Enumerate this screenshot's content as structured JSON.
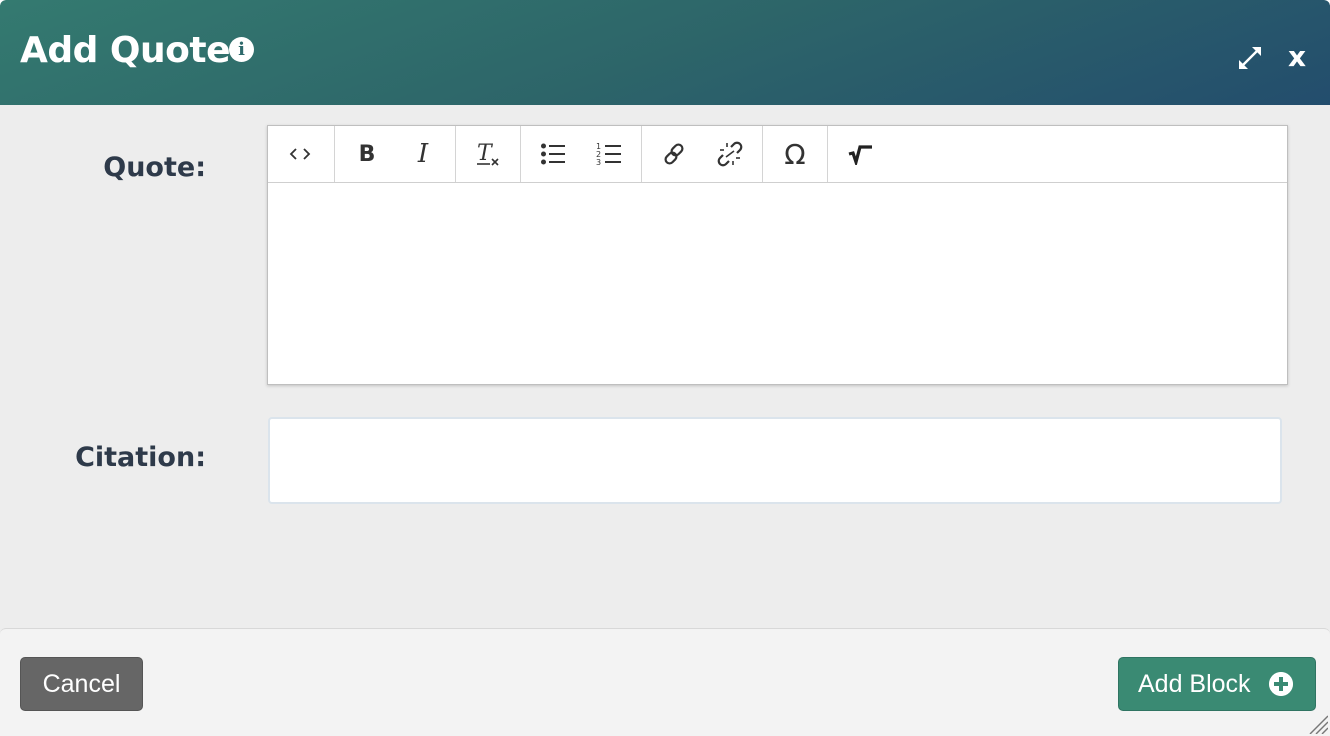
{
  "dialog": {
    "title": "Add Quote",
    "info_icon": "info-icon",
    "expand_icon": "expand-icon",
    "close_label": "x"
  },
  "fields": {
    "quote_label": "Quote:",
    "quote_value": "",
    "citation_label": "Citation:",
    "citation_value": ""
  },
  "toolbar": {
    "buttons": [
      {
        "name": "source-code",
        "icon": "code-icon"
      },
      {
        "name": "bold",
        "glyph": "B"
      },
      {
        "name": "italic",
        "glyph": "I"
      },
      {
        "name": "remove-format",
        "icon": "clear-format-icon"
      },
      {
        "name": "bulleted-list",
        "icon": "bulleted-list-icon"
      },
      {
        "name": "numbered-list",
        "icon": "numbered-list-icon"
      },
      {
        "name": "link",
        "icon": "link-icon"
      },
      {
        "name": "unlink",
        "icon": "unlink-icon"
      },
      {
        "name": "special-character",
        "glyph": "Ω"
      },
      {
        "name": "math",
        "icon": "square-root-icon"
      }
    ]
  },
  "footer": {
    "cancel_label": "Cancel",
    "add_label": "Add Block"
  },
  "colors": {
    "header_start": "#347a70",
    "header_end": "#234d6d",
    "add_button": "#3a8a73",
    "cancel_button": "#666666"
  }
}
